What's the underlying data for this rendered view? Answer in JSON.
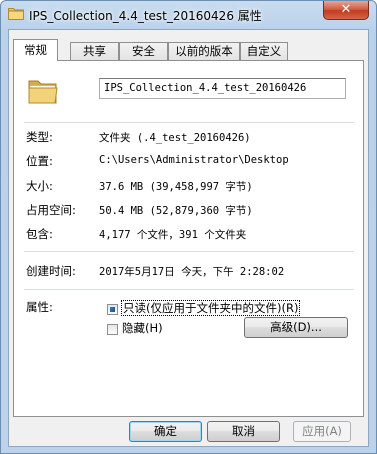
{
  "window": {
    "title": "IPS_Collection_4.4_test_20160426 属性",
    "close_glyph": "✕"
  },
  "tabs": [
    {
      "label": "常规",
      "active": true
    },
    {
      "label": "共享",
      "active": false
    },
    {
      "label": "安全",
      "active": false
    },
    {
      "label": "以前的版本",
      "active": false
    },
    {
      "label": "自定义",
      "active": false
    }
  ],
  "general": {
    "folder_name": "IPS_Collection_4.4_test_20160426",
    "rows": [
      {
        "label": "类型:",
        "value": "文件夹 (.4_test_20160426)"
      },
      {
        "label": "位置:",
        "value": "C:\\Users\\Administrator\\Desktop"
      },
      {
        "label": "大小:",
        "value": "37.6 MB (39,458,997 字节)"
      },
      {
        "label": "占用空间:",
        "value": "50.4 MB (52,879,360 字节)"
      },
      {
        "label": "包含:",
        "value": "4,177 个文件，391 个文件夹"
      }
    ],
    "created": {
      "label": "创建时间:",
      "value": "2017年5月17日 今天，下午 2:28:02"
    },
    "attributes": {
      "label": "属性:",
      "readonly_label": "只读(仅应用于文件夹中的文件)(R)",
      "hidden_label": "隐藏(H)",
      "advanced_label": "高级(D)..."
    }
  },
  "buttons": {
    "ok": "确定",
    "cancel": "取消",
    "apply": "应用(A)"
  },
  "icons": {
    "app": "folder-icon",
    "folder": "folder-icon",
    "close": "close-icon"
  }
}
